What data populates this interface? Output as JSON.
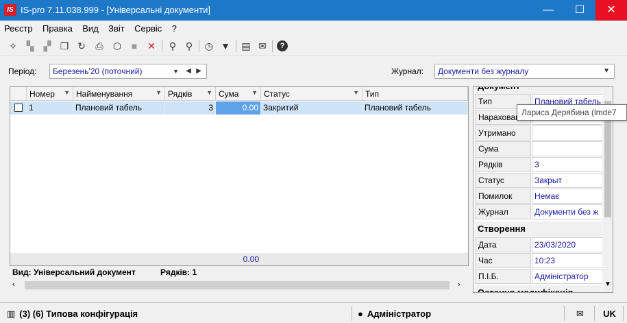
{
  "window": {
    "title": "IS-pro 7.11.038.999 - [Універсальні документи]",
    "logo": "IS",
    "minimize": "—",
    "maximize": "☐",
    "close": "✕"
  },
  "menu": [
    "Реєстр",
    "Правка",
    "Вид",
    "Звіт",
    "Сервіс",
    "?"
  ],
  "toolbar": {
    "icons": [
      "new-doc-icon",
      "copy-icon",
      "copy-multi-icon",
      "duplicate-icon",
      "refresh-icon",
      "print-icon",
      "export-icon",
      "stop-icon",
      "delete-icon",
      "find-icon",
      "find-next-icon",
      "timer-icon",
      "filter-icon",
      "form-icon",
      "mail-icon",
      "help-icon"
    ]
  },
  "filters": {
    "period_label": "Період:",
    "period_value": "Березень'20 (поточний)",
    "journal_label": "Журнал:",
    "journal_value": "Документи без журналу"
  },
  "grid": {
    "columns": [
      "Номер",
      "Найменування",
      "Рядків",
      "Сума",
      "Статус",
      "Тип"
    ],
    "rows": [
      {
        "num": "1",
        "name": "Плановий табель",
        "rows": "3",
        "sum": "0.00",
        "status": "Закритий",
        "type": "Плановий табель"
      }
    ],
    "total_sum": "0.00",
    "view_label": "Вид: Універсальний документ",
    "rows_count_label": "Рядків: 1"
  },
  "panel": {
    "section_top": "Документ",
    "fields": [
      {
        "key": "Тип",
        "value": "Плановий табель"
      },
      {
        "key": "Нарахован",
        "value": ""
      },
      {
        "key": "Утримано",
        "value": ""
      },
      {
        "key": "Сума",
        "value": ""
      },
      {
        "key": "Рядків",
        "value": "3"
      },
      {
        "key": "Статус",
        "value": "Закрыт"
      },
      {
        "key": "Помилок",
        "value": "Немає"
      },
      {
        "key": "Журнал",
        "value": "Документи без ж"
      }
    ],
    "section_creation": "Створення",
    "creation": [
      {
        "key": "Дата",
        "value": "23/03/2020"
      },
      {
        "key": "Час",
        "value": "10:23"
      },
      {
        "key": "П.І.Б.",
        "value": "Адміністратор"
      }
    ],
    "section_bottom": "Остання модифікація"
  },
  "tooltip": "Лариса Дерябина (lmde7",
  "statusbar": {
    "config": "(3) (6) Типова конфігурація",
    "user": "Адміністратор",
    "lang": "UK"
  },
  "colors": {
    "title_bg": "#1e78c8",
    "close_bg": "#e81123",
    "selection": "#cfe3f7",
    "link_text": "#1a1aa6"
  }
}
